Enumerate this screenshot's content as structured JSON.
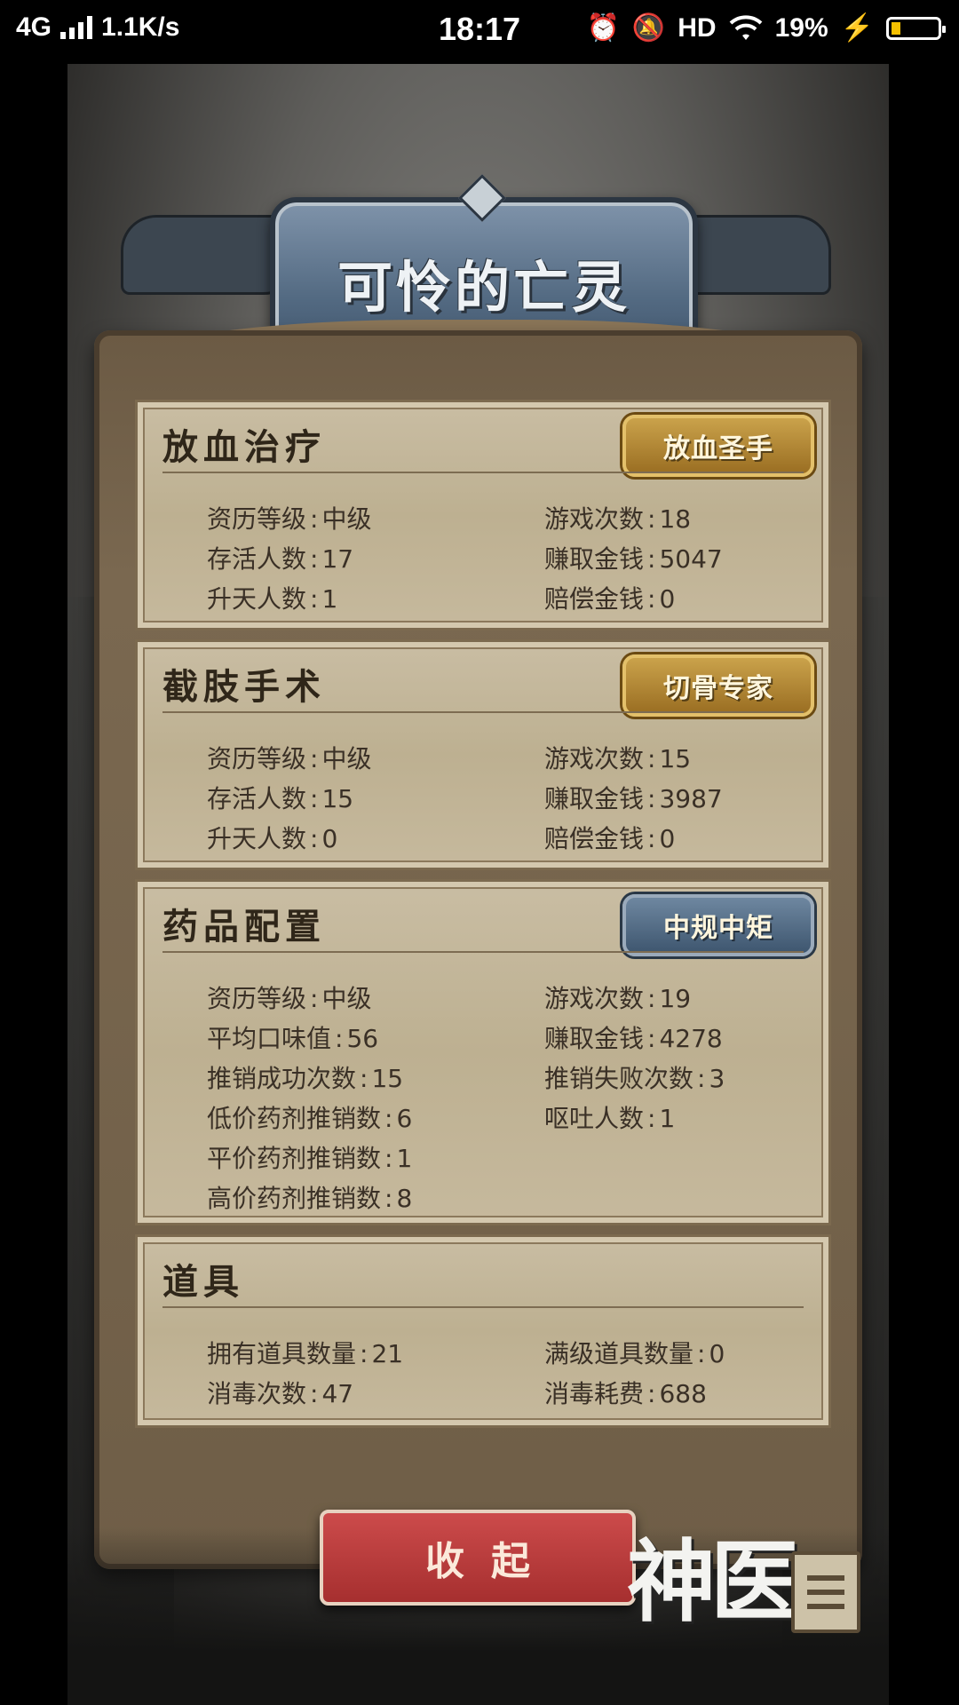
{
  "status_bar": {
    "network": "4G",
    "speed": "1.1K/s",
    "time": "18:17",
    "hd": "HD",
    "battery_percent": "19%",
    "battery_level": 0.19,
    "battery_fill_color": "#f5c000"
  },
  "title": "可怜的亡灵",
  "sections": [
    {
      "title": "放血治疗",
      "badge": "放血圣手",
      "badge_style": "gold",
      "stats": [
        {
          "label": "资历等级",
          "value": "中级"
        },
        {
          "label": "游戏次数",
          "value": "18"
        },
        {
          "label": "存活人数",
          "value": "17"
        },
        {
          "label": "赚取金钱",
          "value": "5047"
        },
        {
          "label": "升天人数",
          "value": "1"
        },
        {
          "label": "赔偿金钱",
          "value": "0"
        }
      ]
    },
    {
      "title": "截肢手术",
      "badge": "切骨专家",
      "badge_style": "gold",
      "stats": [
        {
          "label": "资历等级",
          "value": "中级"
        },
        {
          "label": "游戏次数",
          "value": "15"
        },
        {
          "label": "存活人数",
          "value": "15"
        },
        {
          "label": "赚取金钱",
          "value": "3987"
        },
        {
          "label": "升天人数",
          "value": "0"
        },
        {
          "label": "赔偿金钱",
          "value": "0"
        }
      ]
    },
    {
      "title": "药品配置",
      "badge": "中规中矩",
      "badge_style": "blue",
      "stats": [
        {
          "label": "资历等级",
          "value": "中级"
        },
        {
          "label": "游戏次数",
          "value": "19"
        },
        {
          "label": "平均口味值",
          "value": "56"
        },
        {
          "label": "赚取金钱",
          "value": "4278"
        },
        {
          "label": "推销成功次数",
          "value": "15"
        },
        {
          "label": "推销失败次数",
          "value": "3"
        },
        {
          "label": "低价药剂推销数",
          "value": "6"
        },
        {
          "label": "呕吐人数",
          "value": "1"
        },
        {
          "label": "平价药剂推销数",
          "value": "1"
        },
        {
          "label": "高价药剂推销数",
          "value": "8"
        }
      ]
    },
    {
      "title": "道具",
      "stats": [
        {
          "label": "拥有道具数量",
          "value": "21"
        },
        {
          "label": "满级道具数量",
          "value": "0"
        },
        {
          "label": "消毒次数",
          "value": "47"
        },
        {
          "label": "消毒耗费",
          "value": "688"
        }
      ]
    }
  ],
  "collapse_button": "收起",
  "logo": "神医",
  "icons": {
    "signal": "signal-bars-icon",
    "alarm": "alarm-icon",
    "mute": "bell-off-icon",
    "wifi": "wifi-icon",
    "charging": "bolt-icon",
    "battery": "battery-icon",
    "menu": "menu-list-icon"
  },
  "colors": {
    "parchment": "#c9bda3",
    "gold_badge": "#caa24b",
    "blue_badge": "#6e87a0",
    "collapse_button": "#cc4b4b"
  }
}
